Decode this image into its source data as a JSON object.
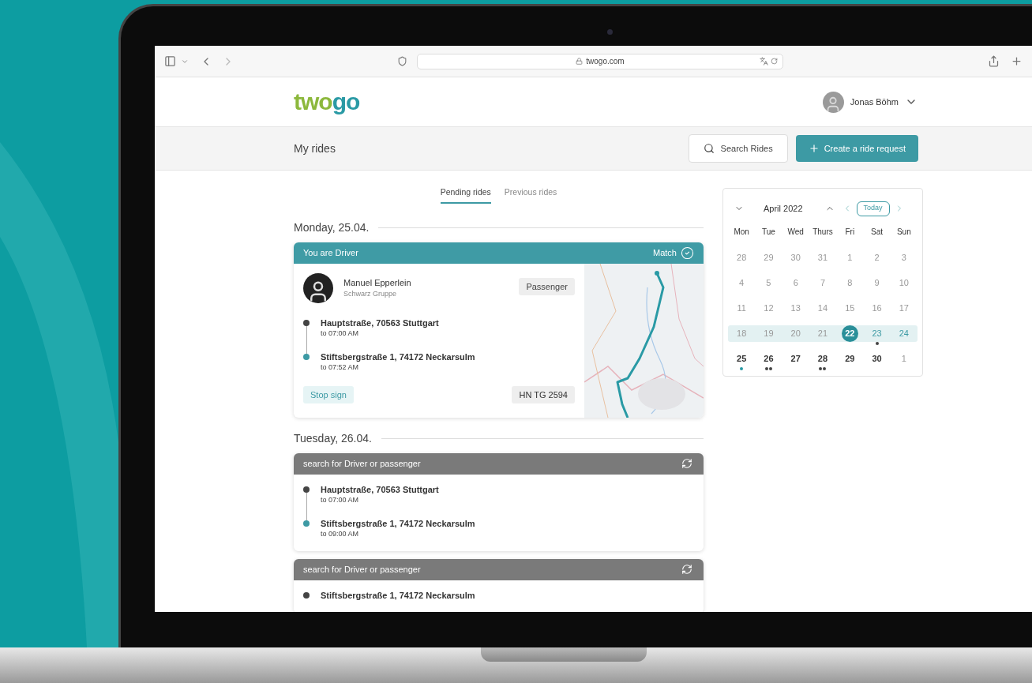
{
  "browser": {
    "address": "twogo.com"
  },
  "header": {
    "logo": [
      {
        "text": "two",
        "color": "#8cb83c"
      },
      {
        "text": "go",
        "color": "#2a9aa5"
      }
    ],
    "user": {
      "name": "Jonas Böhm"
    }
  },
  "subheader": {
    "title": "My rides",
    "search_button": "Search Rides",
    "create_button": "Create a ride request"
  },
  "tabs": [
    {
      "label": "Pending rides",
      "selected": true
    },
    {
      "label": "Previous rides",
      "selected": false
    }
  ],
  "days": [
    {
      "heading": "Monday, 25.04.",
      "rides": [
        {
          "kind": "driver",
          "title": "You are Driver",
          "status": "Match",
          "person": {
            "name": "Manuel Epperlein",
            "company": "Schwarz Gruppe",
            "role": "Passenger"
          },
          "stops": [
            {
              "kind": "start",
              "address": "Hauptstraße, 70563 Stuttgart",
              "time": "to 07:00 AM"
            },
            {
              "kind": "end",
              "address": "Stiftsbergstraße 1, 74172 Neckarsulm",
              "time": "to 07:52 AM"
            }
          ],
          "action": "Stop sign",
          "plate": "HN TG 2594"
        }
      ]
    },
    {
      "heading": "Tuesday, 26.04.",
      "rides": [
        {
          "kind": "search",
          "title": "search for Driver or passenger",
          "stops": [
            {
              "kind": "start",
              "address": "Hauptstraße, 70563 Stuttgart",
              "time": "to 07:00 AM"
            },
            {
              "kind": "end",
              "address": "Stiftsbergstraße 1, 74172 Neckarsulm",
              "time": "to 09:00 AM"
            }
          ]
        },
        {
          "kind": "search",
          "title": "search for Driver or passenger",
          "stops": [
            {
              "kind": "start",
              "address": "Stiftsbergstraße 1, 74172 Neckarsulm"
            }
          ]
        }
      ]
    }
  ],
  "calendar": {
    "month": "April 2022",
    "today_button": "Today",
    "weekdays": [
      "Mon",
      "Tue",
      "Wed",
      "Thurs",
      "Fri",
      "Sat",
      "Sun"
    ],
    "weeks": [
      {
        "selected": false,
        "days": [
          {
            "text": "28",
            "kind": "past",
            "selected": false
          },
          {
            "text": "29",
            "kind": "past",
            "selected": false
          },
          {
            "text": "30",
            "kind": "past",
            "selected": false
          },
          {
            "text": "31",
            "kind": "past",
            "selected": false
          },
          {
            "text": "1",
            "kind": "past",
            "selected": false
          },
          {
            "text": "2",
            "kind": "past",
            "selected": false
          },
          {
            "text": "3",
            "kind": "past",
            "selected": false
          }
        ]
      },
      {
        "selected": false,
        "days": [
          {
            "text": "4",
            "kind": "past",
            "selected": false
          },
          {
            "text": "5",
            "kind": "past",
            "selected": false
          },
          {
            "text": "6",
            "kind": "past",
            "selected": false
          },
          {
            "text": "7",
            "kind": "past",
            "selected": false
          },
          {
            "text": "8",
            "kind": "past",
            "selected": false
          },
          {
            "text": "9",
            "kind": "past",
            "selected": false
          },
          {
            "text": "10",
            "kind": "past",
            "selected": false
          }
        ]
      },
      {
        "selected": false,
        "days": [
          {
            "text": "11",
            "kind": "past",
            "selected": false
          },
          {
            "text": "12",
            "kind": "past",
            "selected": false
          },
          {
            "text": "13",
            "kind": "past",
            "selected": false
          },
          {
            "text": "14",
            "kind": "past",
            "selected": false
          },
          {
            "text": "15",
            "kind": "past",
            "selected": false
          },
          {
            "text": "16",
            "kind": "past",
            "selected": false
          },
          {
            "text": "17",
            "kind": "past",
            "selected": false
          }
        ]
      },
      {
        "selected": true,
        "days": [
          {
            "text": "18",
            "kind": "past",
            "selected": false
          },
          {
            "text": "19",
            "kind": "past",
            "selected": false
          },
          {
            "text": "20",
            "kind": "past",
            "selected": false
          },
          {
            "text": "21",
            "kind": "past",
            "selected": false
          },
          {
            "text": "22",
            "kind": "future",
            "selected": true
          },
          {
            "text": "23",
            "kind": "week",
            "selected": false,
            "dots": [
              {
                "color": "#444444"
              }
            ]
          },
          {
            "text": "24",
            "kind": "week",
            "selected": false
          }
        ]
      },
      {
        "selected": false,
        "days": [
          {
            "text": "25",
            "kind": "future",
            "selected": false,
            "dots": [
              {
                "color": "#2a9aa5"
              }
            ]
          },
          {
            "text": "26",
            "kind": "future",
            "selected": false,
            "dots": [
              {
                "color": "#444444"
              },
              {
                "color": "#444444"
              }
            ]
          },
          {
            "text": "27",
            "kind": "future",
            "selected": false
          },
          {
            "text": "28",
            "kind": "future",
            "selected": false,
            "dots": [
              {
                "color": "#444444"
              },
              {
                "color": "#444444"
              }
            ]
          },
          {
            "text": "29",
            "kind": "future",
            "selected": false
          },
          {
            "text": "30",
            "kind": "future",
            "selected": false
          },
          {
            "text": "1",
            "kind": "past",
            "selected": false
          }
        ]
      }
    ]
  }
}
